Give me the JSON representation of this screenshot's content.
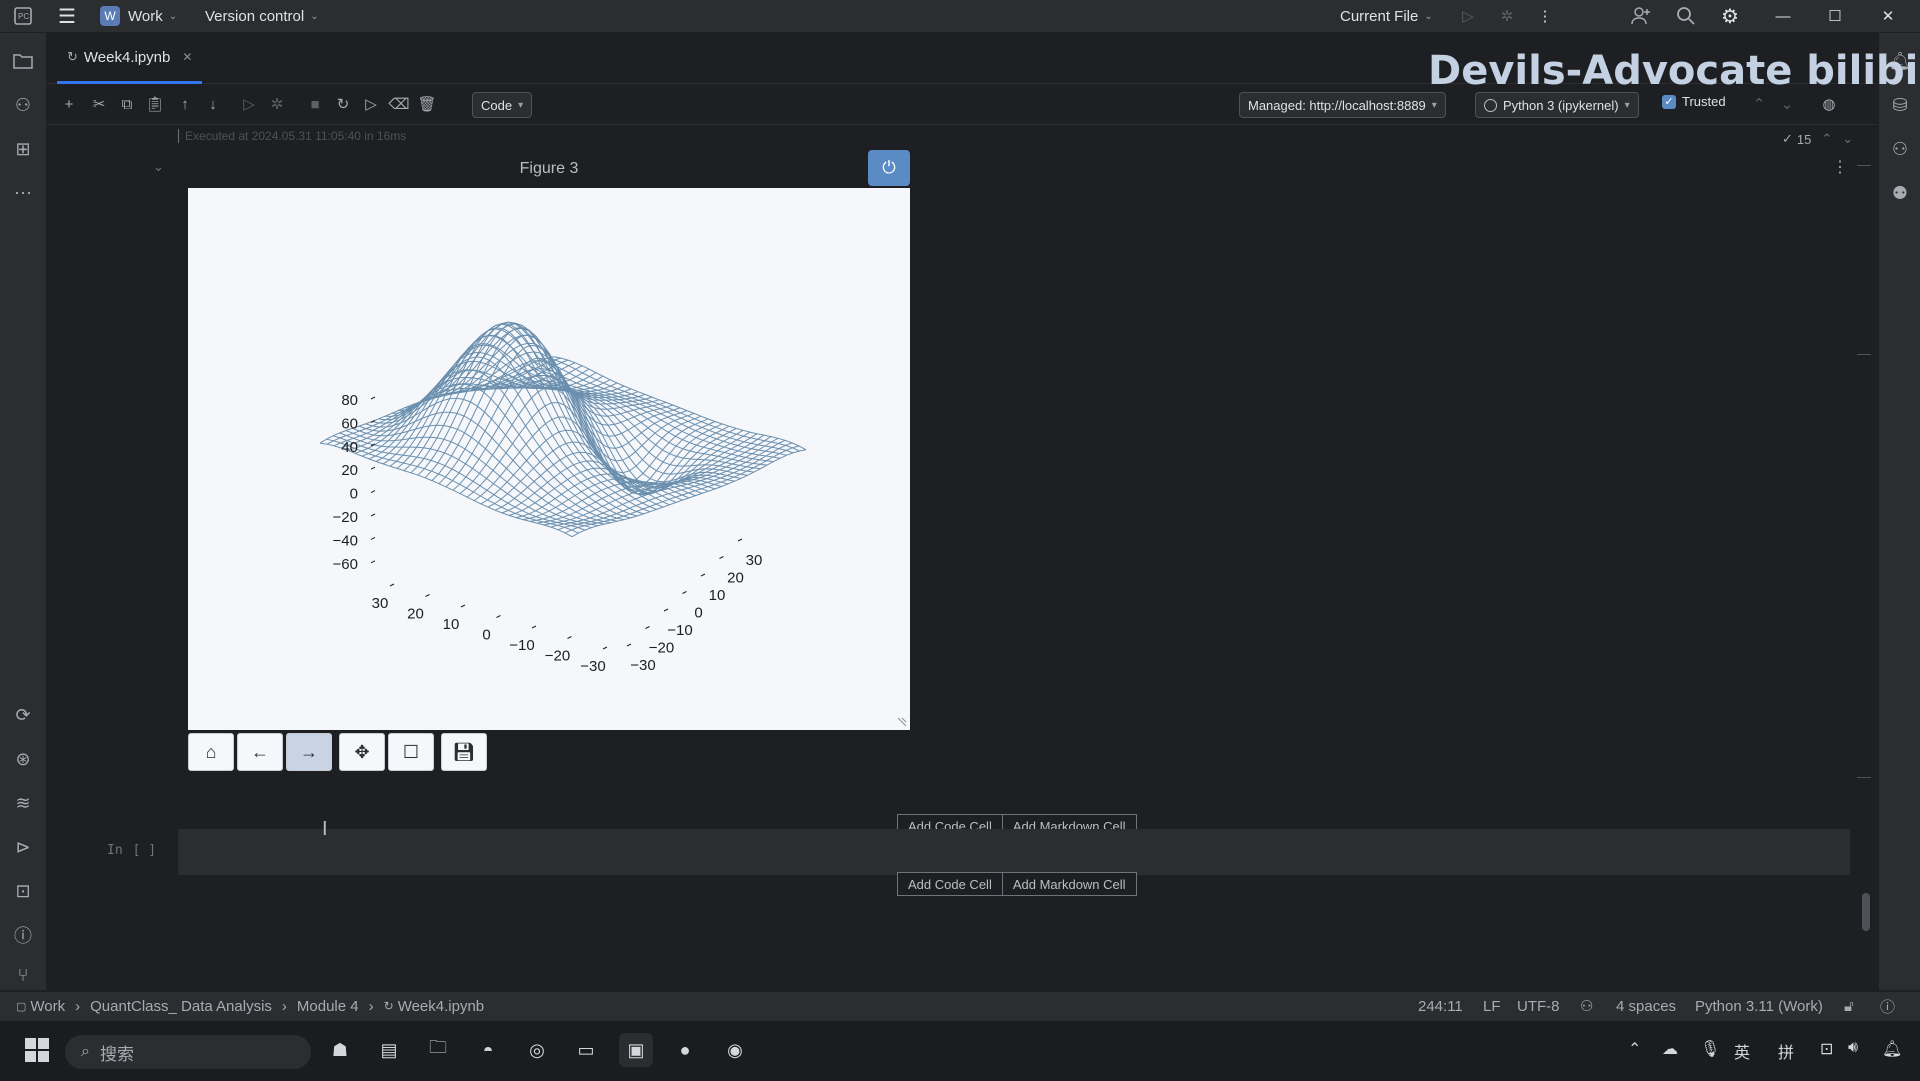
{
  "titlebar": {
    "project": "Work",
    "project_badge": "W",
    "vcs": "Version control",
    "run_config": "Current File"
  },
  "tab": {
    "label": "Week4.ipynb"
  },
  "nb_toolbar": {
    "cell_type": "Code",
    "server": "Managed: http://localhost:8889",
    "kernel": "Python 3 (ipykernel)",
    "trusted": "Trusted",
    "check_count": "15"
  },
  "cell": {
    "executed_text": "Executed at 2024.05.31 11:05:40 in 16ms",
    "in_prompt": "In",
    "in_bracket": "[ ]"
  },
  "figure": {
    "title": "Figure 3",
    "z_ticks": [
      "80",
      "60",
      "40",
      "20",
      "0",
      "−20",
      "−40",
      "−60"
    ],
    "x_ticks": [
      "30",
      "20",
      "10",
      "0",
      "−10",
      "−20",
      "−30"
    ],
    "y_ticks": [
      "30",
      "20",
      "10",
      "0",
      "−10",
      "−20",
      "−30"
    ],
    "surface_color": "#6b8fae",
    "toolbar": [
      "home-icon",
      "back-arrow-icon",
      "forward-arrow-icon",
      "pan-icon",
      "zoom-rect-icon",
      "save-icon"
    ]
  },
  "add_cell": {
    "code": "Add Code Cell",
    "markdown": "Add Markdown Cell"
  },
  "watermark": "Devils-Advocate bilibili",
  "breadcrumbs": [
    "Work",
    "QuantClass_ Data Analysis",
    "Module 4",
    "Week4.ipynb"
  ],
  "status": {
    "position": "244:11",
    "line_ending": "LF",
    "encoding": "UTF-8",
    "indent": "4 spaces",
    "interpreter": "Python 3.11 (Work)"
  },
  "taskbar": {
    "search": "搜索",
    "tray_lang": "英",
    "tray_ime": "拼"
  }
}
